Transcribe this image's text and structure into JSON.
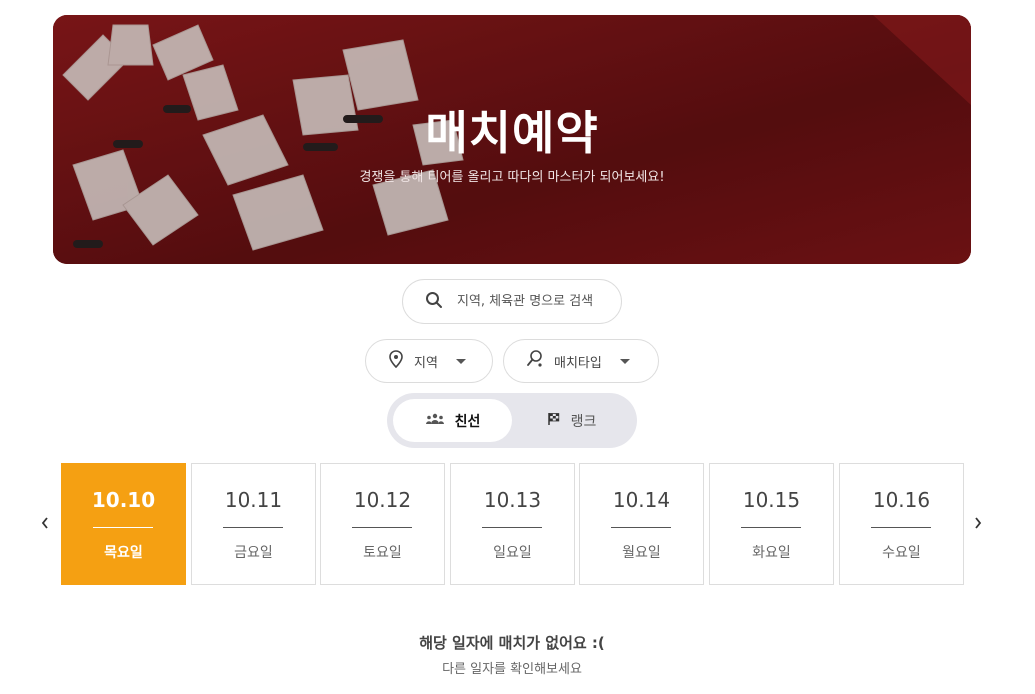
{
  "banner": {
    "title": "매치예약",
    "subtitle": "경쟁을 통해 티어를 올리고 따다의 마스터가 되어보세요!"
  },
  "search": {
    "placeholder": "지역, 체육관 명으로 검색",
    "icon": "search-icon"
  },
  "filters": {
    "region": {
      "label": "지역",
      "icon": "map-pin-icon"
    },
    "match_type": {
      "label": "매치타입",
      "icon": "badminton-racket-icon"
    }
  },
  "mode_toggle": {
    "options": [
      {
        "label": "친선",
        "icon": "group-icon",
        "active": true
      },
      {
        "label": "랭크",
        "icon": "checkered-flag-icon",
        "active": false
      }
    ]
  },
  "dates": [
    {
      "date": "10.10",
      "day": "목요일",
      "selected": true
    },
    {
      "date": "10.11",
      "day": "금요일",
      "selected": false
    },
    {
      "date": "10.12",
      "day": "토요일",
      "selected": false
    },
    {
      "date": "10.13",
      "day": "일요일",
      "selected": false
    },
    {
      "date": "10.14",
      "day": "월요일",
      "selected": false
    },
    {
      "date": "10.15",
      "day": "화요일",
      "selected": false
    },
    {
      "date": "10.16",
      "day": "수요일",
      "selected": false
    }
  ],
  "empty_state": {
    "title": "해당 일자에 매치가 없어요 :(",
    "subtitle": "다른 일자를 확인해보세요"
  },
  "colors": {
    "accent": "#f5a012",
    "banner_bg": "#6e1416"
  }
}
